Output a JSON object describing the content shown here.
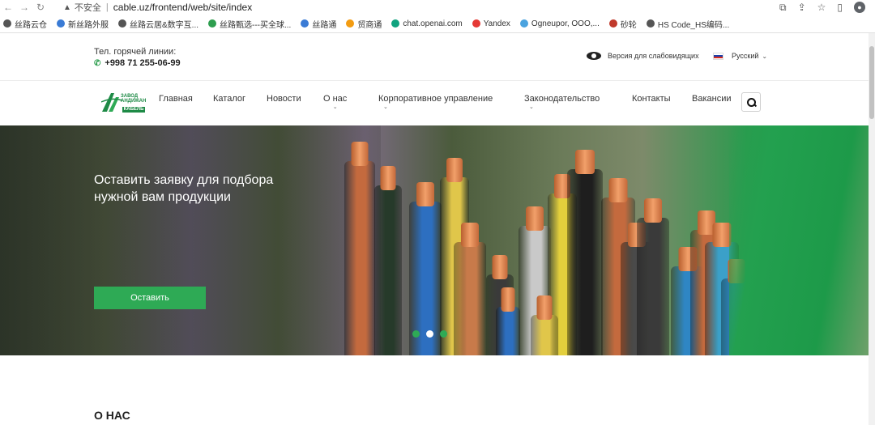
{
  "browser": {
    "insecure_label": "不安全",
    "url": "cable.uz/frontend/web/site/index",
    "bookmarks": [
      {
        "label": "丝路云仓",
        "color": "#555555"
      },
      {
        "label": "新丝路外服",
        "color": "#3a7bd5"
      },
      {
        "label": "丝路云居&数字互...",
        "color": "#555555"
      },
      {
        "label": "丝路甄选---买全球...",
        "color": "#2e9e4f"
      },
      {
        "label": "丝路通",
        "color": "#3a7bd5"
      },
      {
        "label": "贸商通",
        "color": "#f39c12"
      },
      {
        "label": "chat.openai.com",
        "color": "#10a37f"
      },
      {
        "label": "Yandex",
        "color": "#e53935"
      },
      {
        "label": "Ogneupor, OOO,...",
        "color": "#4aa3df"
      },
      {
        "label": "砂轮",
        "color": "#c0392b"
      },
      {
        "label": "HS Code_HS编码...",
        "color": "#555555"
      }
    ]
  },
  "header": {
    "hotline_label": "Тел. горячей линии:",
    "hotline_number": "+998 71 255-06-99",
    "vision_label": "Версия для слабовидящих",
    "language": "Русский"
  },
  "logo": {
    "line1": "ЗАВОД",
    "line2": "АНДИЖАН",
    "bar": "КАБЕЛЬ"
  },
  "menu": {
    "items": [
      {
        "label": "Главная"
      },
      {
        "label": "Каталог"
      },
      {
        "label": "Новости"
      },
      {
        "label": "О нас"
      },
      {
        "label": "Корпоративное управление"
      },
      {
        "label": "Законодательство"
      },
      {
        "label": "Контакты"
      },
      {
        "label": "Вакансии"
      }
    ]
  },
  "hero": {
    "title": "Оставить заявку для подбора нужной вам продукции",
    "button": "Оставить",
    "slides": 3,
    "active_slide": 2
  },
  "about": {
    "title": "О НАС"
  },
  "colors": {
    "accent": "#2eaa55",
    "brand": "#1e8a46"
  }
}
